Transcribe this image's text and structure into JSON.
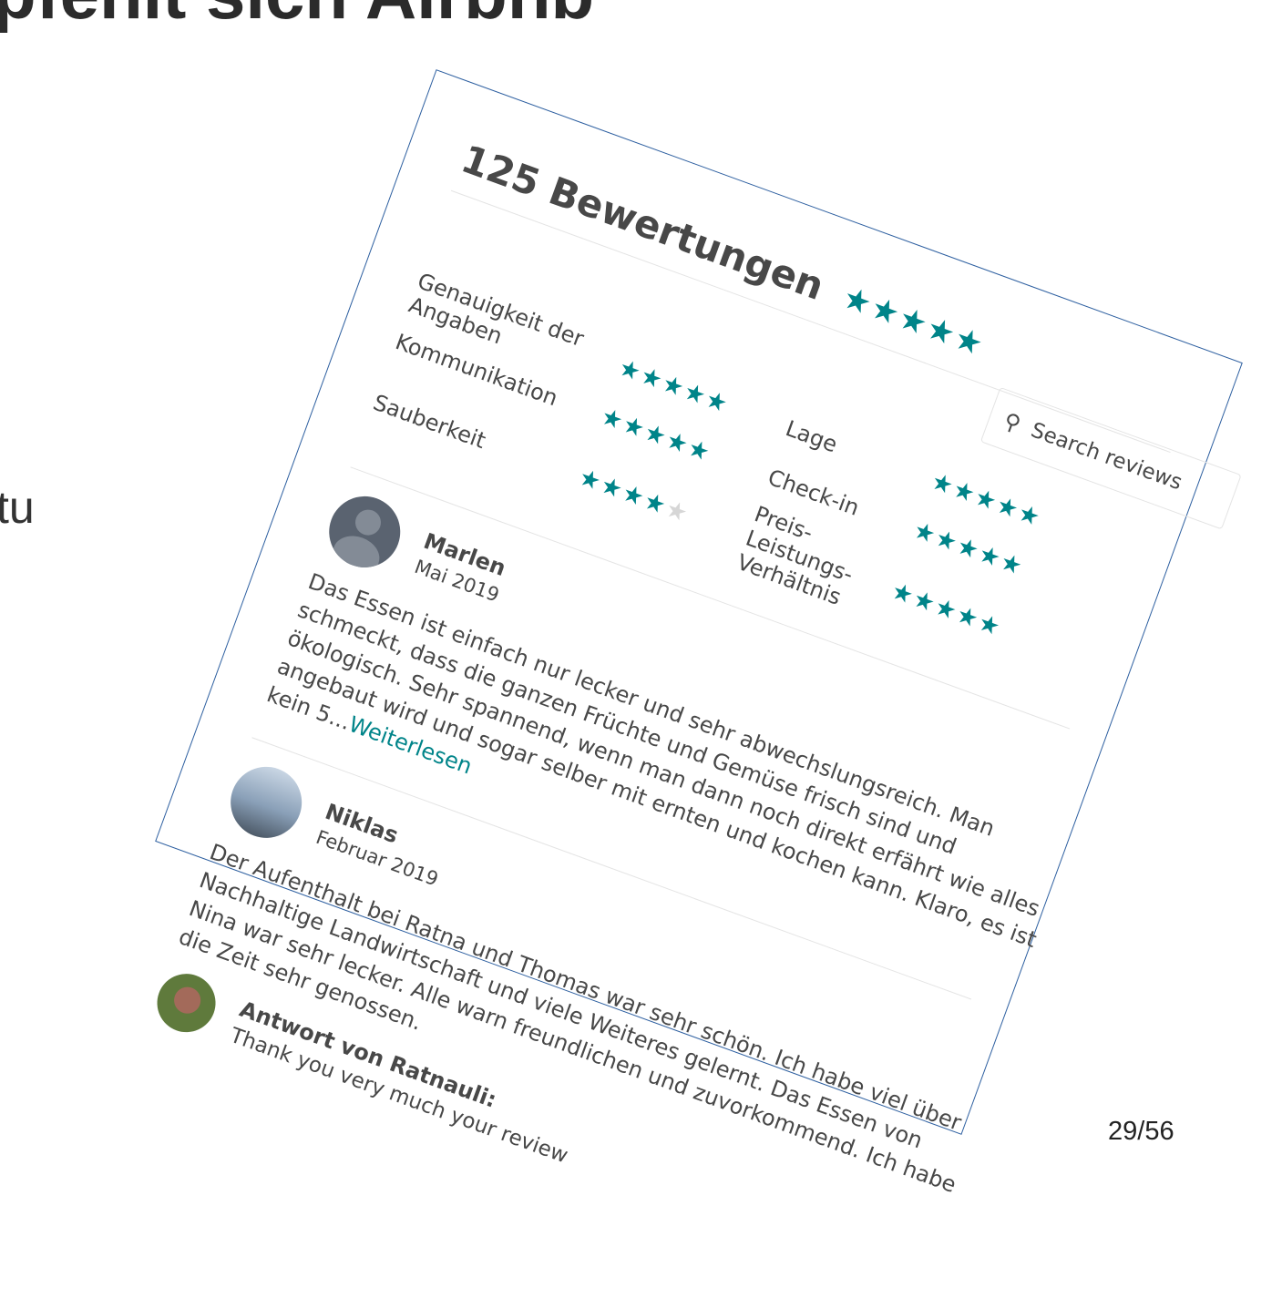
{
  "slide": {
    "title": "pfehlt sich Airbnb",
    "fragment": "tu",
    "page_number": "29/56"
  },
  "reviews_panel": {
    "heading": "125 Bewertungen",
    "overall_stars": "★★★★★",
    "search": {
      "placeholder": "Search reviews"
    },
    "categories": [
      {
        "label": "Genauigkeit der Angaben",
        "stars": "★★★★★"
      },
      {
        "label": "Lage",
        "stars": "★★★★★"
      },
      {
        "label": "Kommunikation",
        "stars": "★★★★★"
      },
      {
        "label": "Check-in",
        "stars": "★★★★★"
      },
      {
        "label": "Sauberkeit",
        "stars": "★★★★",
        "half_star": "★"
      },
      {
        "label": "Preis-Leistungs-Verhältnis",
        "stars": "★★★★★"
      }
    ],
    "reviews": [
      {
        "name": "Marlen",
        "date": "Mai 2019",
        "text": "Das Essen ist einfach nur lecker und sehr abwechslungsreich. Man schmeckt, dass die ganzen Früchte und Gemüse frisch sind und ökologisch. Sehr spannend, wenn man dann noch direkt erfährt wie alles angebaut wird und sogar selber mit ernten und kochen kann. Klaro, es ist kein 5...",
        "read_more": "Weiterlesen"
      },
      {
        "name": "Niklas",
        "date": "Februar 2019",
        "text": "Der Aufenthalt bei Ratna und Thomas war sehr schön. Ich habe viel über Nachhaltige Landwirtschaft und viele Weiteres gelernt. Das Essen von Nina war sehr lecker. Alle warn freundlichen und zuvorkommend. Ich habe die Zeit sehr genossen."
      }
    ],
    "response": {
      "label": "Antwort von Ratnauli:",
      "text": "Thank you very much your review"
    }
  }
}
